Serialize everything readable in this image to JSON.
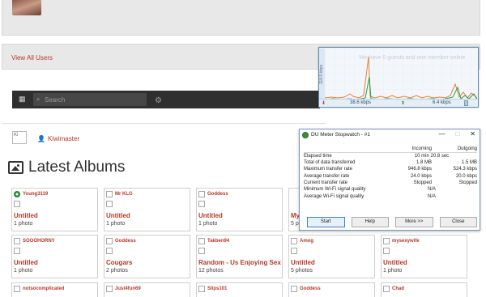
{
  "top": {
    "avatar": "user-avatar"
  },
  "users": {
    "view_all": "View All Users"
  },
  "search": {
    "placeholder": "Search"
  },
  "profile": {
    "broken_alt": "Ki",
    "username": "Kiwimaster"
  },
  "albums_section": {
    "title": "Latest Albums"
  },
  "albums": [
    {
      "owner": "Young3119",
      "title": "Untitled",
      "count": "1 photo",
      "flag": true
    },
    {
      "owner": "Mr KLG",
      "title": "Untitled",
      "count": "1 photo"
    },
    {
      "owner": "Goddess",
      "title": "Untitled",
      "count": "1 photo"
    },
    {
      "owner": "",
      "title": "My",
      "count": "5 p"
    },
    {
      "owner": "SOOOHORNY",
      "title": "Untitled",
      "count": "1 photo"
    },
    {
      "owner": "Goddess",
      "title": "Cougars",
      "count": "2 photos"
    },
    {
      "owner": "Takben94",
      "title": "Random - Us Enjoying Sex",
      "count": "12 photos"
    },
    {
      "owner": "Amog",
      "title": "Untitled",
      "count": "5 photos"
    },
    {
      "owner": "mysexywife",
      "title": "Untitled",
      "count": "1 photo"
    },
    {
      "owner": "notsocomplicated",
      "title": "",
      "count": ""
    },
    {
      "owner": "Just4fun69",
      "title": "",
      "count": ""
    },
    {
      "owner": "Slips101",
      "title": "",
      "count": ""
    },
    {
      "owner": "Goddess",
      "title": "",
      "count": ""
    },
    {
      "owner": "Chad",
      "title": "",
      "count": ""
    }
  ],
  "du_graph": {
    "axis_label": "118.5 kbps",
    "overlay_text": "We have 0 guests and one member online",
    "download_rate": "38.6 kbps",
    "upload_rate": "6.4 kbps",
    "download_color": "#e6803a",
    "upload_color": "#2a9a4f"
  },
  "stopwatch": {
    "title": "DU Meter Stopwatch - #1",
    "headers": {
      "incoming": "Incoming",
      "outgoing": "Outgoing"
    },
    "rows": [
      {
        "label": "Elapsed time",
        "value": "10 min 20.8 sec"
      },
      {
        "label": "Total of data transferred",
        "incoming": "1.8 MB",
        "outgoing": "1.5 MB"
      },
      {
        "label": "Maximum transfer rate",
        "incoming": "946.8 kbps",
        "outgoing": "524.3 kbps"
      },
      {
        "label": "Average transfer rate",
        "incoming": "24.0 kbps",
        "outgoing": "20.0 kbps"
      },
      {
        "label": "Current transfer rate",
        "incoming": "Stopped",
        "outgoing": "Stopped"
      },
      {
        "label": "Minimum Wi-Fi signal quality",
        "value": "N/A"
      },
      {
        "label": "Average Wi-Fi signal quality",
        "value": "N/A"
      }
    ],
    "buttons": {
      "start": "Start",
      "help": "Help",
      "more": "More >>",
      "close": "Close"
    }
  }
}
